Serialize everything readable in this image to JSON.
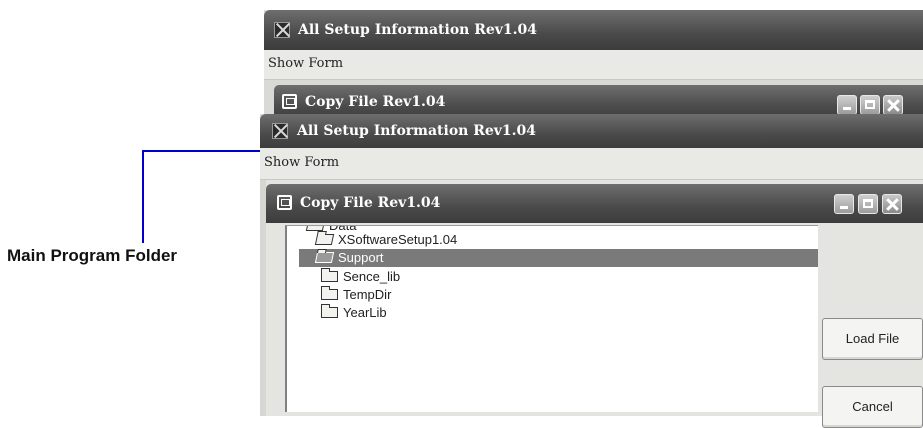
{
  "callout": {
    "label": "Main Program Folder",
    "line_color": "#0000cc"
  },
  "back_window": {
    "title": "All Setup Information Rev1.04",
    "menu": "Show Form",
    "child_title": "Copy File Rev1.04"
  },
  "front_window": {
    "title": "All Setup Information Rev1.04",
    "menu": "Show Form",
    "child_title": "Copy File Rev1.04"
  },
  "tree": {
    "items": [
      {
        "label": "Data",
        "state": "open",
        "partially_visible": true
      },
      {
        "label": "XSoftwareSetup1.04",
        "state": "open"
      },
      {
        "label": "Support",
        "state": "open",
        "selected": true
      },
      {
        "label": "Sence_lib",
        "state": "closed"
      },
      {
        "label": "TempDir",
        "state": "closed"
      },
      {
        "label": "YearLib",
        "state": "closed"
      }
    ]
  },
  "buttons": {
    "load": "Load File",
    "cancel": "Cancel"
  },
  "icons": {
    "app": "app-window-icon",
    "copy": "copy-file-window-icon",
    "folder": "folder-icon",
    "minimize": "minimize-icon",
    "maximize": "maximize-icon",
    "close": "close-icon"
  },
  "colors": {
    "titlebar": "#4a4a4a",
    "selection": "#7a7a7a",
    "menubar": "#e9e9e6"
  }
}
